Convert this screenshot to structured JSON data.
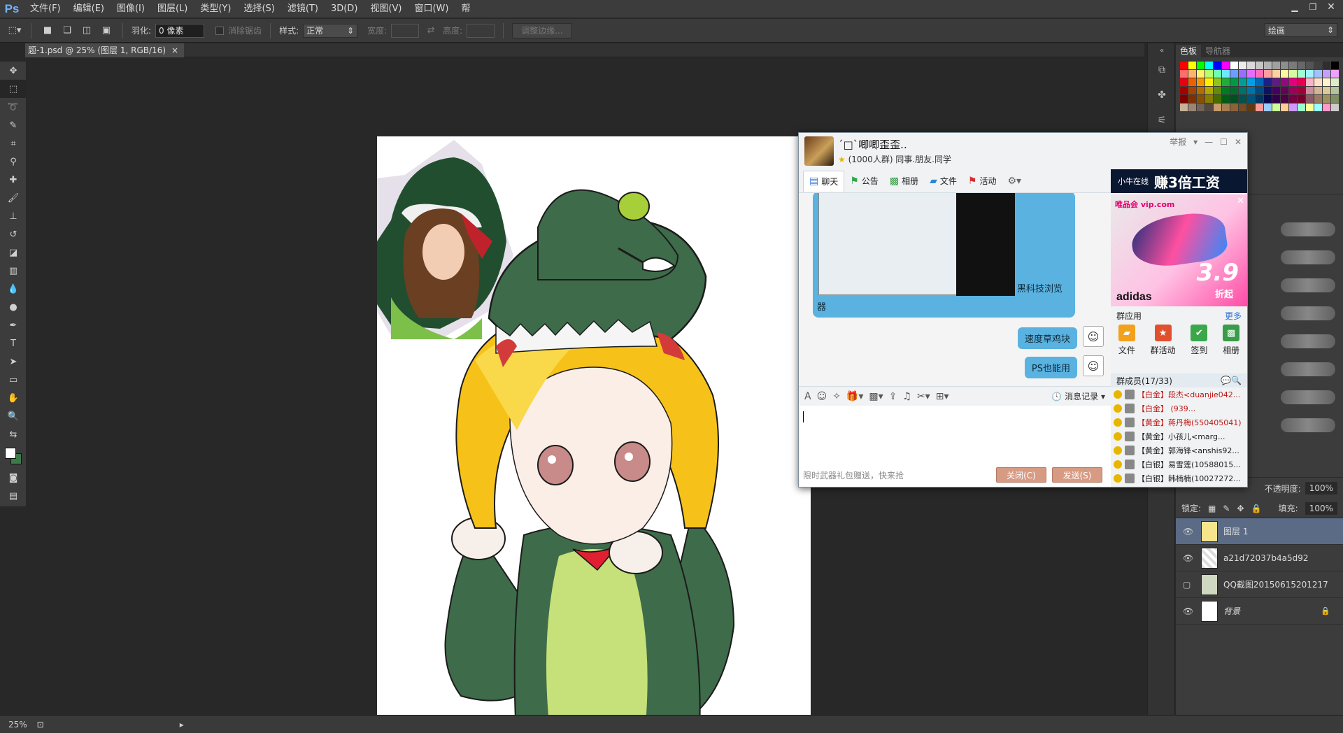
{
  "menubar": {
    "logo": "Ps",
    "items": [
      "文件(F)",
      "编辑(E)",
      "图像(I)",
      "图层(L)",
      "类型(Y)",
      "选择(S)",
      "滤镜(T)",
      "3D(D)",
      "视图(V)",
      "窗口(W)",
      "帮"
    ]
  },
  "options": {
    "feather_label": "羽化:",
    "feather_value": "0 像素",
    "antialias_label": "消除锯齿",
    "style_label": "样式:",
    "style_value": "正常",
    "width_label": "宽度:",
    "height_label": "高度:",
    "refine_edge": "调整边缘...",
    "workspace": "绘画"
  },
  "document": {
    "tab_title": "题-1.psd @ 25% (图层 1, RGB/16)",
    "tab_close": "×"
  },
  "statusbar": {
    "zoom": "25%"
  },
  "panels": {
    "tabs": [
      "色板",
      "导航器"
    ],
    "swatch_colors": [
      "#ff0000",
      "#ffff00",
      "#00ff00",
      "#00ffff",
      "#0000ff",
      "#ff00ff",
      "#ffffff",
      "#ececec",
      "#d9d9d9",
      "#c6c6c6",
      "#b3b3b3",
      "#a0a0a0",
      "#8d8d8d",
      "#7a7a7a",
      "#676767",
      "#545454",
      "#414141",
      "#2e2e2e",
      "#000000",
      "#ff6d6d",
      "#ffb36d",
      "#fff36d",
      "#b8ff6d",
      "#6dffb0",
      "#6de9ff",
      "#6d9dff",
      "#9b6dff",
      "#e46dff",
      "#ff6db8",
      "#ff9e9e",
      "#ffd0a0",
      "#fff7a0",
      "#d4ffa0",
      "#a0ffd0",
      "#a0f3ff",
      "#a0c3ff",
      "#c3a0ff",
      "#f0a0ff",
      "#e60012",
      "#eb6100",
      "#f39800",
      "#fff100",
      "#8fc31f",
      "#22ac38",
      "#009944",
      "#009e96",
      "#00a0e9",
      "#0068b7",
      "#1d2088",
      "#601986",
      "#920783",
      "#e4007f",
      "#e5004f",
      "#f7b6c8",
      "#fde0c7",
      "#fff2cc",
      "#dcedc8",
      "#a40000",
      "#a84200",
      "#b56d00",
      "#b5a800",
      "#638c0b",
      "#007b24",
      "#006d2f",
      "#00706a",
      "#0072a5",
      "#004a80",
      "#0d1361",
      "#440062",
      "#67005b",
      "#9e0059",
      "#a0003a",
      "#c88f9e",
      "#d4b396",
      "#d9cc99",
      "#b3c49c",
      "#7d0000",
      "#7f3000",
      "#875100",
      "#877e00",
      "#486b00",
      "#005b17",
      "#004f20",
      "#00524e",
      "#00537a",
      "#00355f",
      "#060a4a",
      "#31004a",
      "#4b0044",
      "#740042",
      "#76002a",
      "#8a5a66",
      "#9a7b62",
      "#9d915f",
      "#7e8f64",
      "#c7b299",
      "#998675",
      "#736357",
      "#534741",
      "#c69c6d",
      "#a67c52",
      "#8c6239",
      "#754c24",
      "#603913",
      "#ff9999",
      "#99ccff",
      "#ccff99",
      "#ffcc99",
      "#cc99ff",
      "#99ffcc",
      "#ffff99",
      "#99ffff",
      "#ff99cc",
      "#cccccc"
    ]
  },
  "layers": {
    "opacity_label": "不透明度:",
    "opacity_value": "100%",
    "lock_label": "锁定:",
    "fill_label": "填充:",
    "fill_value": "100%",
    "items": [
      {
        "name": "图层 1",
        "selected": true
      },
      {
        "name": "a21d72037b4a5d92",
        "selected": false
      },
      {
        "name": "QQ截图20150615201217",
        "selected": false
      },
      {
        "name": "背景",
        "selected": false
      }
    ]
  },
  "qq": {
    "title": "´□`唧唧歪歪..",
    "subtitle": "(1000人群) 同事.朋友.同学",
    "report": "举报",
    "tabs": [
      "聊天",
      "公告",
      "相册",
      "文件",
      "活动"
    ],
    "image_caption": "黑科技浏览",
    "image_caption2": "器",
    "messages": [
      "速度草鸡块",
      "PS也能用"
    ],
    "history": "消息记录",
    "input_hint": "限时武器礼包赠送，快来抢",
    "close_btn": "关闭(C)",
    "send_btn": "发送(S)",
    "ad_brand": "小牛在线",
    "ad_slogan": "赚3倍工资",
    "ad_vip": "唯品会 vip.com",
    "ad_price": "3.9",
    "ad_discount": "折起",
    "ad_adidas": "adidas",
    "apps_title": "群应用",
    "apps_more": "更多",
    "apps": [
      "文件",
      "群活动",
      "签到",
      "相册"
    ],
    "members_title": "群成员(17/33)",
    "members": [
      {
        "text": "【白金】段杰<duanjie042...",
        "cls": "red"
      },
      {
        "text": "【白金】                 (939...",
        "cls": "red"
      },
      {
        "text": "【黄金】蒋丹梅(550405041)",
        "cls": "red"
      },
      {
        "text": "【黄金】小孩儿<marg...",
        "cls": "dark"
      },
      {
        "text": "【黄金】郭海锋<anshis92...",
        "cls": "dark"
      },
      {
        "text": "【白银】易雪莲(10588015...",
        "cls": "dark"
      },
      {
        "text": "【白银】韩楠楠(10027272...",
        "cls": "dark"
      }
    ]
  }
}
